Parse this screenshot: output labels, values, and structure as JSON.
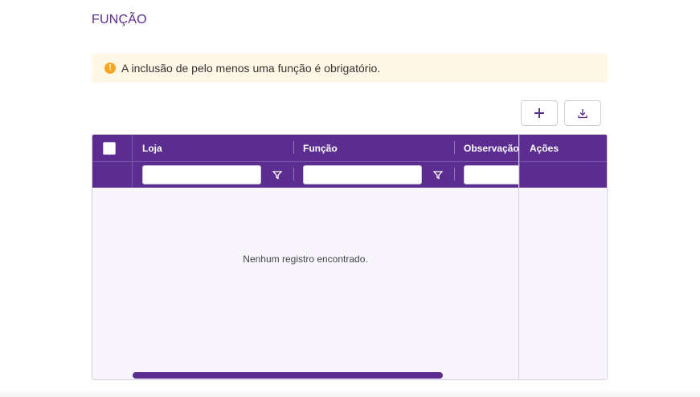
{
  "section": {
    "title": "FUNÇÃO"
  },
  "alert": {
    "icon": "warning-icon",
    "text": "A inclusão de pelo menos uma função é obrigatório."
  },
  "toolbar": {
    "add_icon": "plus-icon",
    "download_icon": "download-icon"
  },
  "grid": {
    "columns": [
      {
        "key": "loja",
        "label": "Loja"
      },
      {
        "key": "funcao",
        "label": "Função"
      },
      {
        "key": "observacao",
        "label": "Observação"
      },
      {
        "key": "acoes",
        "label": "Ações"
      }
    ],
    "filter_icon": "filter-icon",
    "empty_message": "Nenhum registro encontrado.",
    "rows": []
  },
  "colors": {
    "accent": "#5c2d91",
    "alert_bg": "#fff8e6",
    "warning": "#f5a623"
  }
}
